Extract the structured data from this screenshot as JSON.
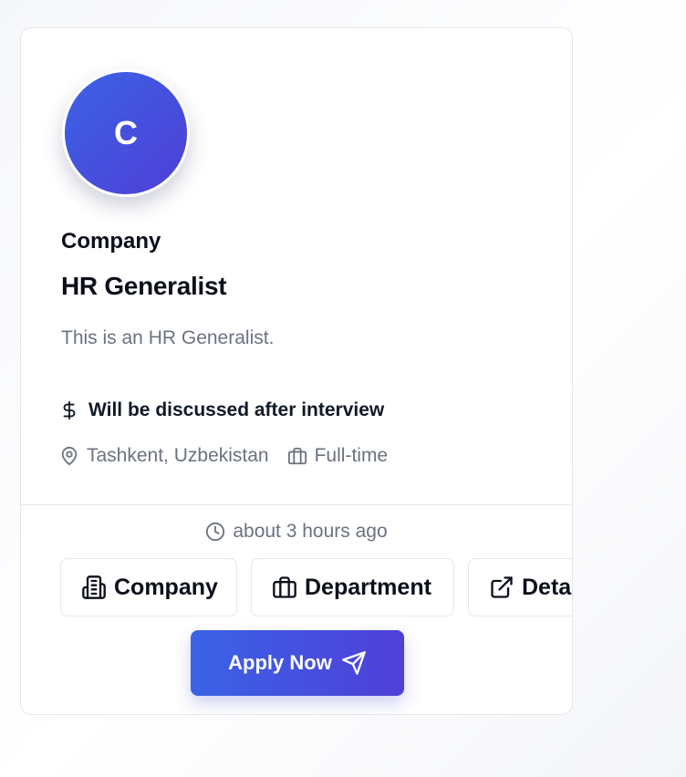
{
  "job": {
    "avatar_letter": "C",
    "company": "Company",
    "title": "HR Generalist",
    "description": "This is an HR Generalist.",
    "salary": "Will be discussed after interview",
    "location": "Tashkent, Uzbekistan",
    "employment_type": "Full-time",
    "posted": "about 3 hours ago"
  },
  "actions": {
    "company_label": "Company",
    "department_label": "Department",
    "details_label": "Details",
    "apply_label": "Apply Now"
  },
  "icons": {
    "salary": "dollar-icon",
    "location": "map-pin-icon",
    "employment_type": "briefcase-icon",
    "posted": "clock-icon",
    "company": "building-icon",
    "department": "briefcase-icon",
    "details": "external-link-icon",
    "apply": "send-icon"
  },
  "colors": {
    "accent_start": "#3b63e6",
    "accent_end": "#4f3ed6",
    "muted_text": "#6b7280",
    "heading_text": "#0b0f19",
    "border": "#e5e7eb"
  }
}
